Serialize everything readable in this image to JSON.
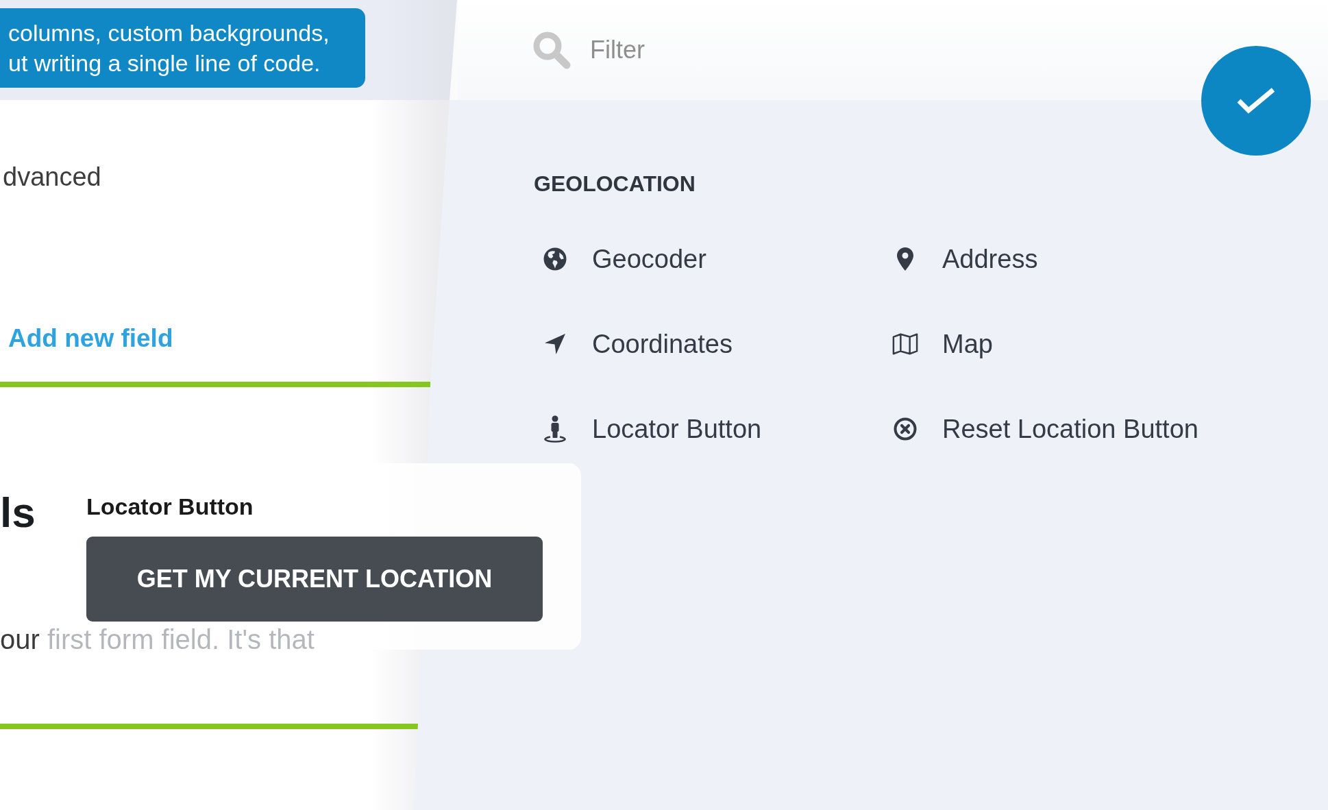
{
  "banner": {
    "lines": [
      "columns, custom backgrounds,",
      "ut writing a single line of code."
    ]
  },
  "form_editor": {
    "tab_label": "dvanced",
    "add_field_link": "Add new field",
    "heading": "ls",
    "paragraph": "our first form field. It's that"
  },
  "preview": {
    "label": "Locator Button",
    "button": "GET MY CURRENT LOCATION"
  },
  "field_picker": {
    "filter": {
      "placeholder": "Filter"
    },
    "section_title": "GEOLOCATION",
    "items": [
      {
        "kind": "geocoder",
        "label": "Geocoder"
      },
      {
        "kind": "address",
        "label": "Address"
      },
      {
        "kind": "coordinates",
        "label": "Coordinates"
      },
      {
        "kind": "map",
        "label": "Map"
      },
      {
        "kind": "locator",
        "label": "Locator Button"
      },
      {
        "kind": "reset",
        "label": "Reset Location Button"
      }
    ]
  }
}
